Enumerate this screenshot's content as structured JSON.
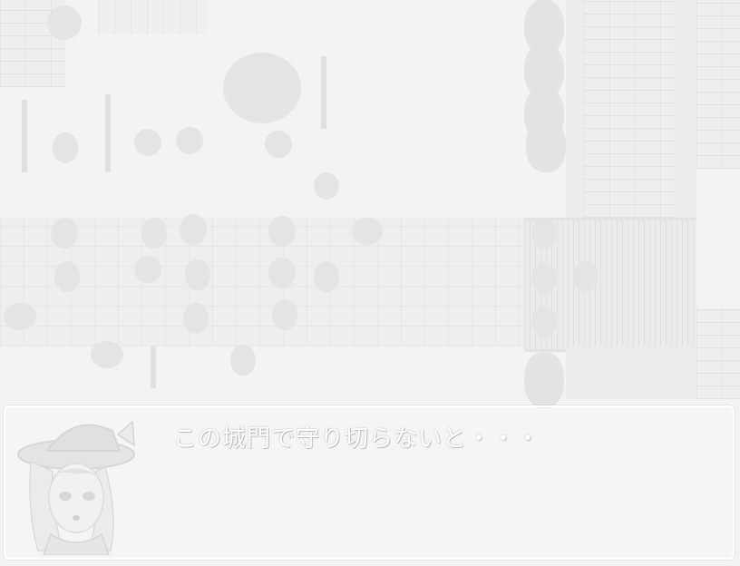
{
  "message_window": {
    "text": "この城門で守り切らないと・・・",
    "text_color": "#ffffff",
    "border_color": "#ffffff"
  },
  "portrait": {
    "icon": "witch-girl-portrait"
  },
  "scene": {
    "background_color": "#f3f3f3",
    "style": "washed-out map with town gate, bridge, dead trees and monsters"
  }
}
